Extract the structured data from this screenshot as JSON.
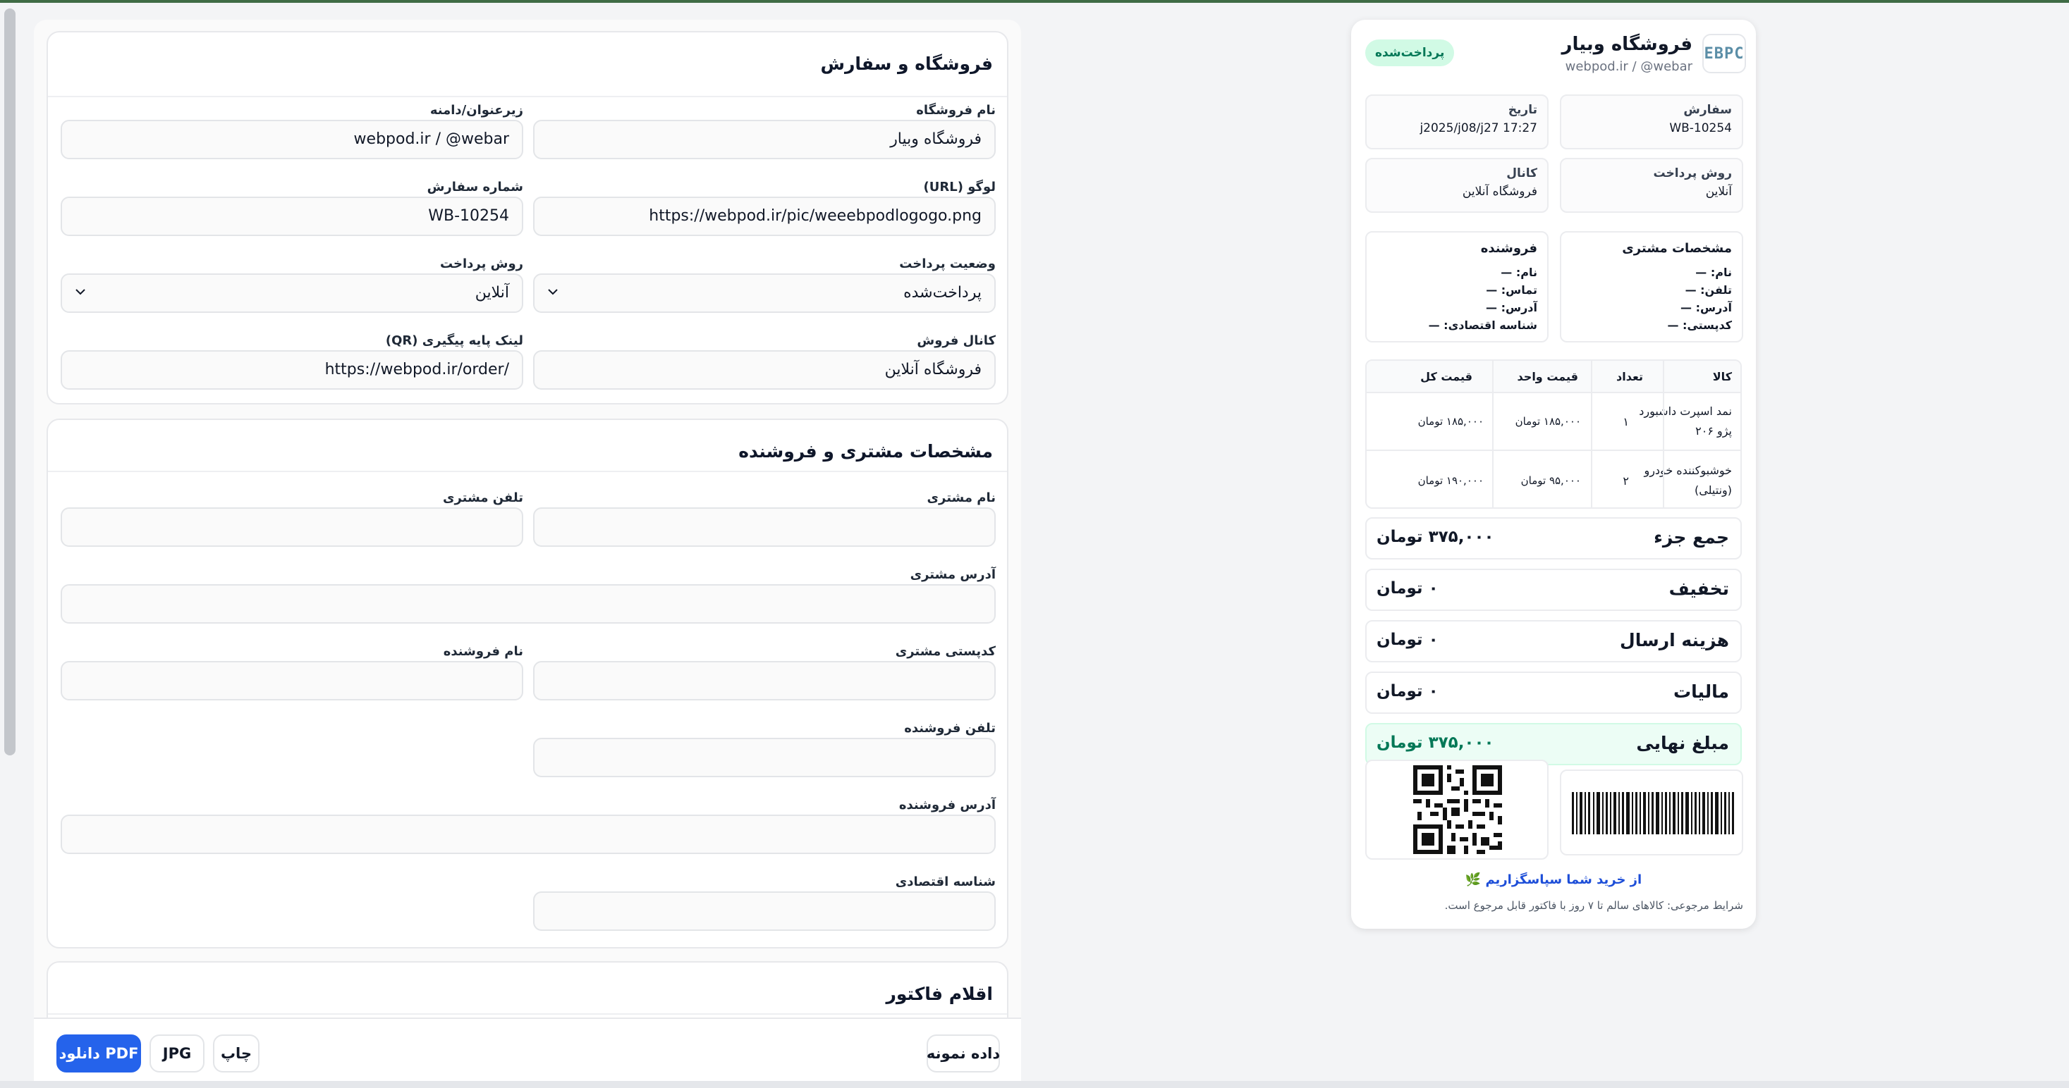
{
  "form": {
    "store_section": {
      "title": "فروشگاه و سفارش",
      "store_name_label": "نام فروشگاه",
      "store_name_value": "فروشگاه وبیار",
      "subtitle_label": "زیرعنوان/دامنه",
      "subtitle_value": "webpod.ir / @webar",
      "logo_label": "لوگو (URL)",
      "logo_value": "https://webpod.ir/pic/weeebpodlogogo.png",
      "order_no_label": "شماره سفارش",
      "order_no_value": "WB-10254",
      "payment_status_label": "وضعیت پرداخت",
      "payment_status_value": "پرداخت‌شده",
      "payment_method_label": "روش پرداخت",
      "payment_method_value": "آنلاین",
      "channel_label": "کانال فروش",
      "channel_value": "فروشگاه آنلاین",
      "qr_label": "لینک پایه پیگیری (QR)",
      "qr_value": "https://webpod.ir/order/"
    },
    "party_section": {
      "title": "مشخصات مشتری و فروشنده",
      "customer_name_label": "نام مشتری",
      "customer_phone_label": "تلفن مشتری",
      "customer_address_label": "آدرس مشتری",
      "customer_postal_label": "کدپستی مشتری",
      "seller_name_label": "نام فروشنده",
      "seller_phone_label": "تلفن فروشنده",
      "seller_address_label": "آدرس فروشنده",
      "economic_id_label": "شناسه اقتصادی"
    },
    "items_section": {
      "title": "اقلام فاکتور"
    }
  },
  "toolbar": {
    "sample_label": "داده نمونه",
    "print_label": "چاپ",
    "jpg_label": "JPG",
    "pdf_label": "دانلود PDF"
  },
  "invoice": {
    "logo_text": "EBPC",
    "store_name": "فروشگاه وبیار",
    "subtitle": "webpod.ir / @webar",
    "status_badge": "پرداخت‌شده",
    "order_label": "سفارش",
    "order_value": "WB-10254",
    "date_label": "تاریخ",
    "date_value": "j2025/j08/j27 17:27",
    "method_label": "روش پرداخت",
    "method_value": "آنلاین",
    "channel_label": "کانال",
    "channel_value": "فروشگاه آنلاین",
    "customer": {
      "title": "مشخصات مشتری",
      "rows": [
        "نام: —",
        "تلفن: —",
        "آدرس: —",
        "کدپستی: —"
      ]
    },
    "seller": {
      "title": "فروشنده",
      "rows": [
        "نام: —",
        "تماس: —",
        "آدرس: —",
        "شناسه اقتصادی: —"
      ]
    },
    "table": {
      "headers": [
        "کالا",
        "تعداد",
        "قیمت واحد",
        "قیمت کل"
      ],
      "rows": [
        {
          "item_line1": "نمد اسپرت داشبورد",
          "item_line2": "پژو ۲۰۶",
          "qty": "۱",
          "unit": "۱۸۵,۰۰۰ تومان",
          "total": "۱۸۵,۰۰۰ تومان"
        },
        {
          "item_line1": "خوشبوکننده خودرو",
          "item_line2": "(ونتیلی)",
          "qty": "۲",
          "unit": "۹۵,۰۰۰ تومان",
          "total": "۱۹۰,۰۰۰ تومان"
        }
      ]
    },
    "summary": [
      {
        "label": "جمع جزء",
        "value": "۳۷۵,۰۰۰ تومان"
      },
      {
        "label": "تخفیف",
        "value": "۰ تومان"
      },
      {
        "label": "هزینه ارسال",
        "value": "۰ تومان"
      },
      {
        "label": "مالیات",
        "value": "۰ تومان"
      }
    ],
    "final_label": "مبلغ نهایی",
    "final_value": "۳۷۵,۰۰۰ تومان",
    "thanks": "از خرید شما سپاسگزاریم 🌿",
    "terms": "شرایط مرجوعی: کالاهای سالم تا ۷ روز با فاکتور قابل مرجوع است."
  }
}
